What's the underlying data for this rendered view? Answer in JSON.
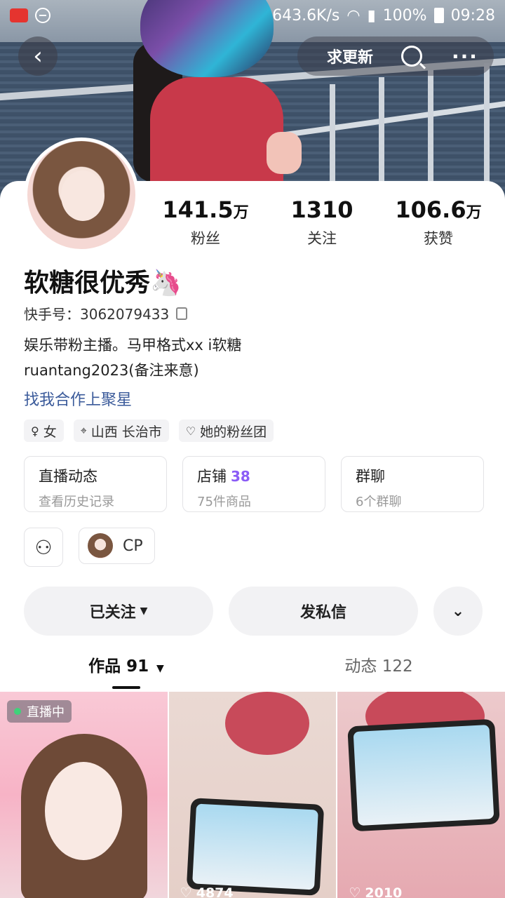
{
  "status": {
    "speed": "643.6K/s",
    "battery": "100%",
    "time": "09:28"
  },
  "nav": {
    "request_update": "求更新"
  },
  "stats": [
    {
      "value": "141.5",
      "unit": "万",
      "label": "粉丝"
    },
    {
      "value": "1310",
      "unit": "",
      "label": "关注"
    },
    {
      "value": "106.6",
      "unit": "万",
      "label": "获赞"
    }
  ],
  "profile": {
    "name": "软糖很优秀",
    "name_emoji": "🦄",
    "kuaishou_id": "快手号：3062079433",
    "bio_line1": "娱乐带粉主播。马甲格式xx  i软糖",
    "bio_line2": "ruantang2023(备注来意)",
    "link": "找我合作上聚星"
  },
  "tags": [
    {
      "icon": "female-icon",
      "text": "女"
    },
    {
      "icon": "location-icon",
      "text": "山西 长治市"
    },
    {
      "icon": "heart-icon",
      "text": "她的粉丝团"
    }
  ],
  "features": [
    {
      "title": "直播动态",
      "badge": "",
      "sub": "查看历史记录"
    },
    {
      "title": "店铺",
      "badge": "38",
      "sub": "75件商品"
    },
    {
      "title": "群聊",
      "badge": "",
      "sub": "6个群聊"
    }
  ],
  "cp": {
    "label": "CP"
  },
  "actions": {
    "followed": "已关注",
    "message": "发私信"
  },
  "tabs": [
    {
      "label": "作品 91",
      "active": true
    },
    {
      "label": "动态 122",
      "active": false
    }
  ],
  "grid": [
    {
      "live_label": "直播中",
      "likes": ""
    },
    {
      "live_label": "",
      "likes": "4874"
    },
    {
      "live_label": "",
      "likes": "2010"
    }
  ]
}
